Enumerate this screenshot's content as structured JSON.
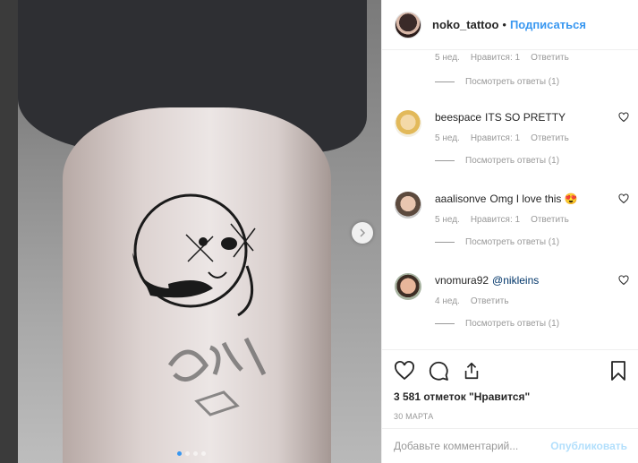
{
  "post": {
    "author": "noko_tattoo",
    "separator": "•",
    "follow_label": "Подписаться",
    "likes": "3 581 отметок \"Нравится\"",
    "date": "30 МАРТА",
    "add_comment_placeholder": "Добавьте комментарий...",
    "publish_label": "Опубликовать",
    "carousel": {
      "slides": 4,
      "active": 0
    }
  },
  "comments": [
    {
      "username": "",
      "text": "",
      "mention": "",
      "time": "5 нед.",
      "likes": "Нравится: 1",
      "reply": "Ответить",
      "view_replies": "Посмотреть ответы (1)"
    },
    {
      "username": "beespace",
      "text": "ITS SO PRETTY",
      "mention": "",
      "time": "5 нед.",
      "likes": "Нравится: 1",
      "reply": "Ответить",
      "view_replies": "Посмотреть ответы (1)"
    },
    {
      "username": "aaalisonve",
      "text": "Omg I love this 😍",
      "mention": "",
      "time": "5 нед.",
      "likes": "Нравится: 1",
      "reply": "Ответить",
      "view_replies": "Посмотреть ответы (1)"
    },
    {
      "username": "vnomura92",
      "text": "",
      "mention": "@nikleins",
      "time": "4 нед.",
      "likes": "",
      "reply": "Ответить",
      "view_replies": "Посмотреть ответы (1)"
    }
  ],
  "icons": [
    "heart-icon",
    "comment-icon",
    "share-icon",
    "bookmark-icon",
    "chevron-right-icon"
  ],
  "colors": {
    "accent": "#3897f0",
    "publish_disabled": "#b2dffc",
    "muted": "#999999"
  }
}
